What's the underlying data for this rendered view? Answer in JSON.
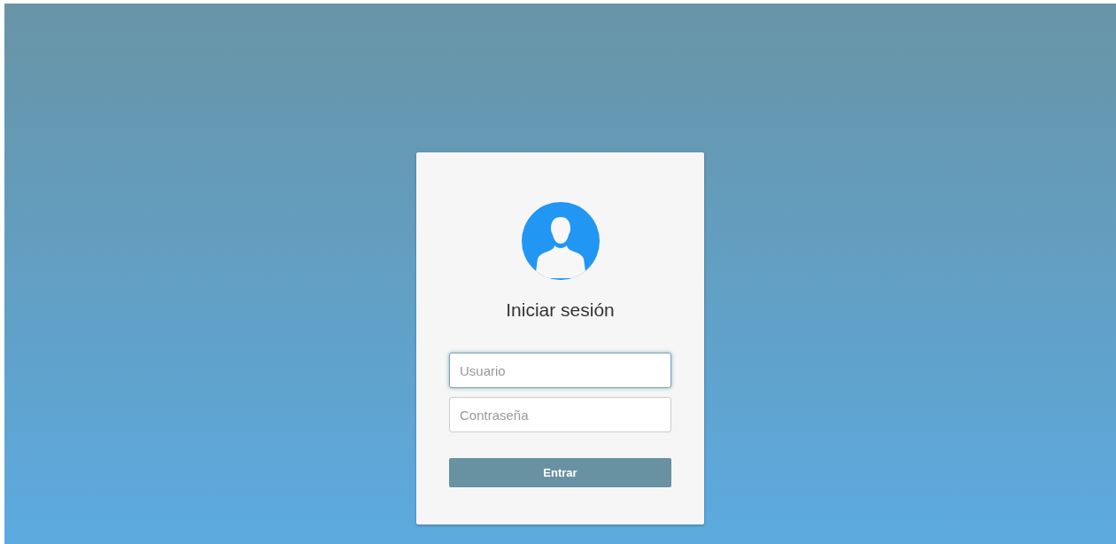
{
  "login": {
    "title": "Iniciar sesión",
    "fields": [
      {
        "placeholder": "Usuario",
        "focused": true
      },
      {
        "placeholder": "Contraseña",
        "focused": false
      }
    ],
    "button": "Entrar"
  }
}
